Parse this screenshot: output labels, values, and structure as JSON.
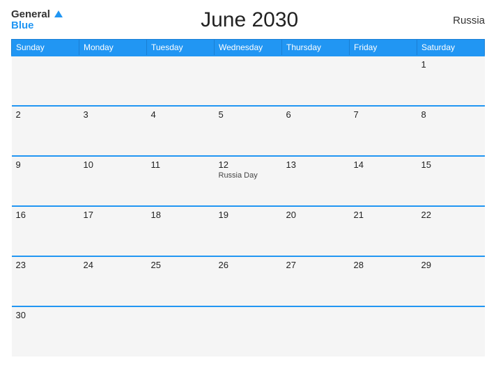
{
  "header": {
    "logo_general": "General",
    "logo_blue": "Blue",
    "title": "June 2030",
    "country": "Russia"
  },
  "weekdays": [
    "Sunday",
    "Monday",
    "Tuesday",
    "Wednesday",
    "Thursday",
    "Friday",
    "Saturday"
  ],
  "weeks": [
    [
      {
        "day": "",
        "event": ""
      },
      {
        "day": "",
        "event": ""
      },
      {
        "day": "",
        "event": ""
      },
      {
        "day": "",
        "event": ""
      },
      {
        "day": "",
        "event": ""
      },
      {
        "day": "",
        "event": ""
      },
      {
        "day": "1",
        "event": ""
      }
    ],
    [
      {
        "day": "2",
        "event": ""
      },
      {
        "day": "3",
        "event": ""
      },
      {
        "day": "4",
        "event": ""
      },
      {
        "day": "5",
        "event": ""
      },
      {
        "day": "6",
        "event": ""
      },
      {
        "day": "7",
        "event": ""
      },
      {
        "day": "8",
        "event": ""
      }
    ],
    [
      {
        "day": "9",
        "event": ""
      },
      {
        "day": "10",
        "event": ""
      },
      {
        "day": "11",
        "event": ""
      },
      {
        "day": "12",
        "event": "Russia Day"
      },
      {
        "day": "13",
        "event": ""
      },
      {
        "day": "14",
        "event": ""
      },
      {
        "day": "15",
        "event": ""
      }
    ],
    [
      {
        "day": "16",
        "event": ""
      },
      {
        "day": "17",
        "event": ""
      },
      {
        "day": "18",
        "event": ""
      },
      {
        "day": "19",
        "event": ""
      },
      {
        "day": "20",
        "event": ""
      },
      {
        "day": "21",
        "event": ""
      },
      {
        "day": "22",
        "event": ""
      }
    ],
    [
      {
        "day": "23",
        "event": ""
      },
      {
        "day": "24",
        "event": ""
      },
      {
        "day": "25",
        "event": ""
      },
      {
        "day": "26",
        "event": ""
      },
      {
        "day": "27",
        "event": ""
      },
      {
        "day": "28",
        "event": ""
      },
      {
        "day": "29",
        "event": ""
      }
    ],
    [
      {
        "day": "30",
        "event": ""
      },
      {
        "day": "",
        "event": ""
      },
      {
        "day": "",
        "event": ""
      },
      {
        "day": "",
        "event": ""
      },
      {
        "day": "",
        "event": ""
      },
      {
        "day": "",
        "event": ""
      },
      {
        "day": "",
        "event": ""
      }
    ]
  ]
}
